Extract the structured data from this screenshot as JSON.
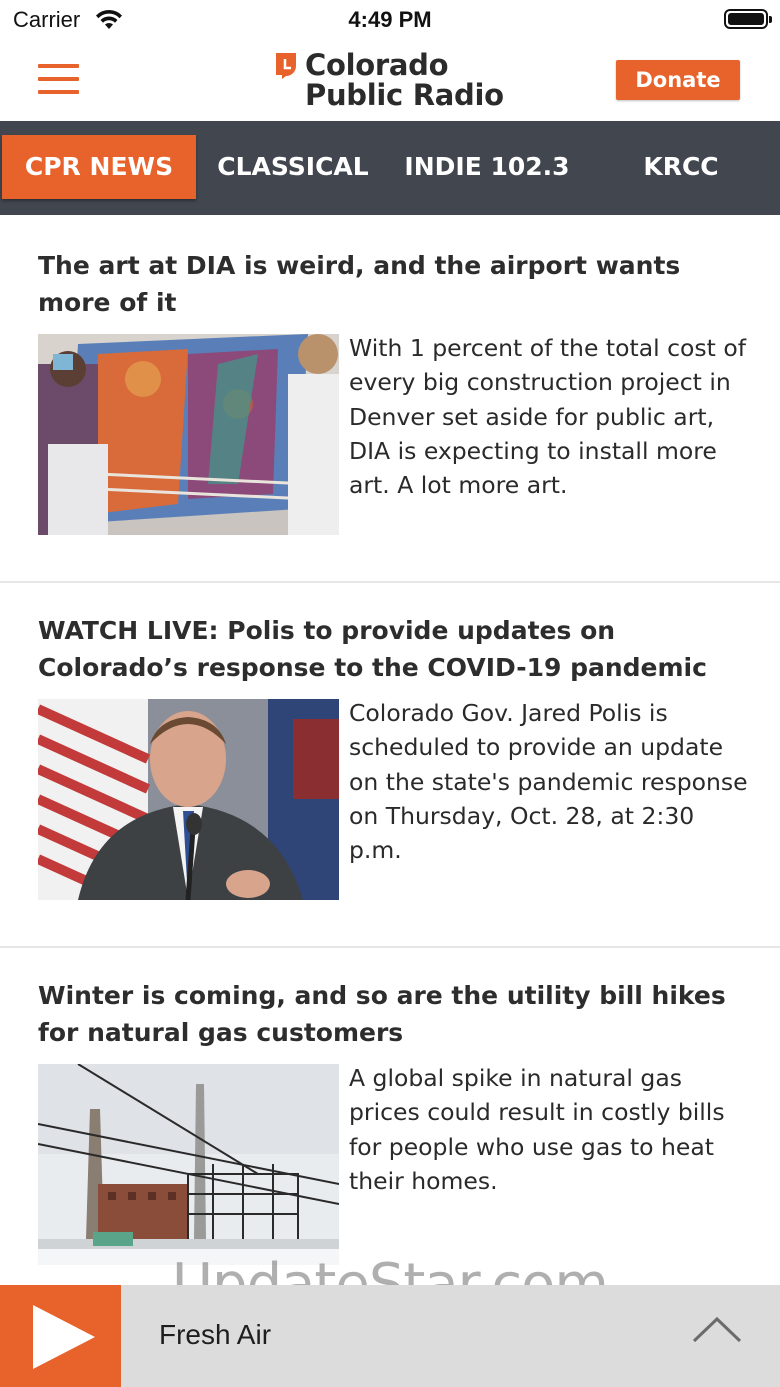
{
  "status_bar": {
    "carrier": "Carrier",
    "time": "4:49 PM"
  },
  "header": {
    "logo_line1": "Colorado",
    "logo_line2": "Public Radio",
    "donate_label": "Donate",
    "accent_color": "#e8622b"
  },
  "tabs": [
    {
      "label": "CPR NEWS",
      "active": true
    },
    {
      "label": "CLASSICAL",
      "active": false
    },
    {
      "label": "INDIE 102.3",
      "active": false
    },
    {
      "label": "KRCC",
      "active": false
    }
  ],
  "articles": [
    {
      "title": "The art at DIA is weird, and the airport wants more of it",
      "summary": "With 1 percent of the total cost of every big construction project in Denver set aside for public art, DIA is expecting to install more art. A lot more art.",
      "image": "mural-installation-photo"
    },
    {
      "title": "WATCH LIVE: Polis to provide updates on Colorado’s response to the COVID-19 pandemic",
      "summary": "Colorado Gov. Jared Polis is scheduled to provide an update on the state's pandemic response on Thursday, Oct. 28, at 2:30 p.m.",
      "image": "governor-press-conference-photo"
    },
    {
      "title": "Winter is coming, and so are the utility bill hikes for natural gas customers",
      "summary": "A global spike in natural gas prices could result in costly bills for people who use gas to heat their homes.",
      "image": "power-plant-photo"
    }
  ],
  "player": {
    "now_playing": "Fresh Air"
  },
  "watermark": "UpdateStar.com"
}
